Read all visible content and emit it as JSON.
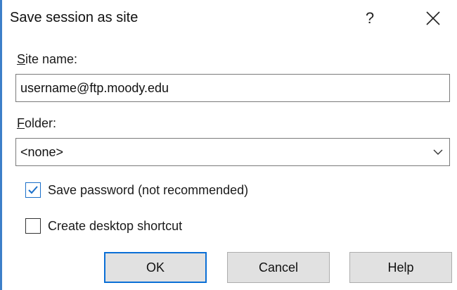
{
  "dialog": {
    "title": "Save session as site",
    "help_glyph": "?",
    "close_icon": "close-icon"
  },
  "site_name": {
    "label_accel": "S",
    "label_rest": "ite name:",
    "value": "username@ftp.moody.edu"
  },
  "folder": {
    "label_accel": "F",
    "label_rest": "older:",
    "selected": "<none>",
    "dropdown_icon": "chevron-down-icon"
  },
  "options": {
    "save_password": {
      "label": "Save password (not recommended)",
      "checked": true
    },
    "desktop_shortcut": {
      "label": "Create desktop shortcut",
      "checked": false
    }
  },
  "buttons": {
    "ok": "OK",
    "cancel": "Cancel",
    "help": "Help"
  },
  "colors": {
    "accent": "#0a6fd6",
    "check": "#1a6fc9",
    "button_face": "#e1e1e1"
  }
}
